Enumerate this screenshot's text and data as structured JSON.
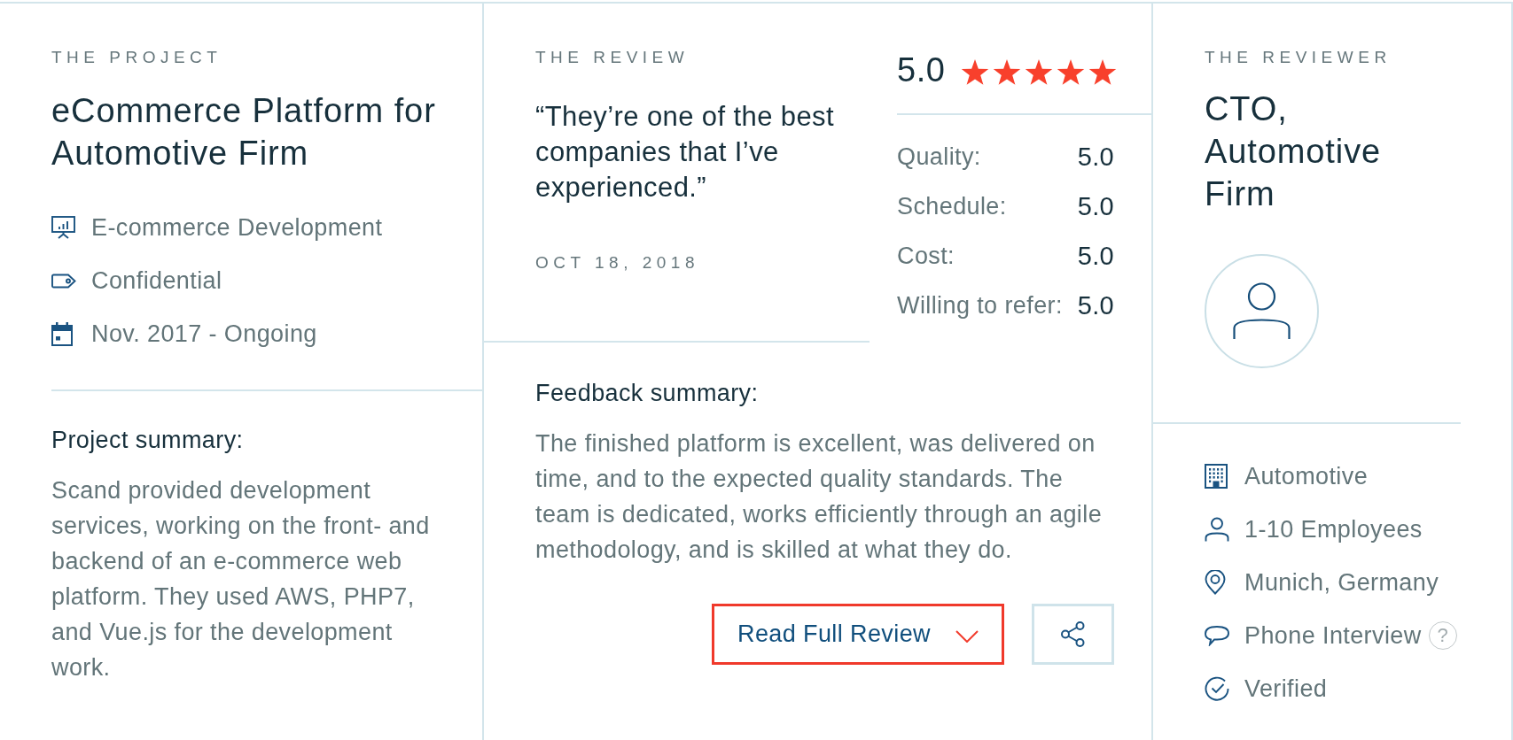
{
  "project": {
    "heading": "THE PROJECT",
    "title": "eCommerce Platform for Automotive Firm",
    "details": [
      {
        "kind": "service",
        "text": "E-commerce Development"
      },
      {
        "kind": "budget",
        "text": "Confidential"
      },
      {
        "kind": "timeline",
        "text": "Nov. 2017 - Ongoing"
      }
    ],
    "summary_heading": "Project summary:",
    "summary": "Scand provided development services, working on the front- and backend of an e-commerce web platform. They used AWS, PHP7, and Vue.js for the development work."
  },
  "review": {
    "heading": "THE REVIEW",
    "quote": "“They’re one of the best companies that I’ve experienced.”",
    "date": "OCT 18, 2018",
    "overall": "5.0",
    "stars": 5,
    "ratings": [
      {
        "label": "Quality:",
        "value": "5.0"
      },
      {
        "label": "Schedule:",
        "value": "5.0"
      },
      {
        "label": "Cost:",
        "value": "5.0"
      },
      {
        "label": "Willing to refer:",
        "value": "5.0"
      }
    ],
    "feedback_heading": "Feedback summary:",
    "feedback": "The finished platform is excellent, was delivered on time, and to the expected quality standards. The team is dedicated, works efficiently through an agile methodology, and is skilled at what they do.",
    "read_more": "Read Full Review"
  },
  "reviewer": {
    "heading": "THE REVIEWER",
    "title": "CTO, Automotive Firm",
    "details": [
      {
        "kind": "industry",
        "text": "Automotive"
      },
      {
        "kind": "size",
        "text": "1-10 Employees"
      },
      {
        "kind": "location",
        "text": "Munich, Germany"
      },
      {
        "kind": "interview",
        "text": "Phone Interview",
        "help": "?"
      },
      {
        "kind": "verified",
        "text": "Verified"
      }
    ]
  }
}
